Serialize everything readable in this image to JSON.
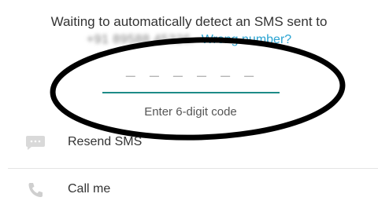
{
  "header": {
    "waiting_text": "Waiting to automatically detect an SMS sent to",
    "phone_number": "+91 89588 45326.",
    "wrong_number_link": "Wrong number?"
  },
  "code_entry": {
    "placeholder": "— — —   — — —",
    "hint": "Enter 6-digit code"
  },
  "options": [
    {
      "label": "Resend SMS",
      "icon": "message-icon"
    },
    {
      "label": "Call me",
      "icon": "phone-icon"
    }
  ],
  "colors": {
    "accent": "#1d8b87",
    "link": "#2aa4d2",
    "annotation": "#000000"
  }
}
